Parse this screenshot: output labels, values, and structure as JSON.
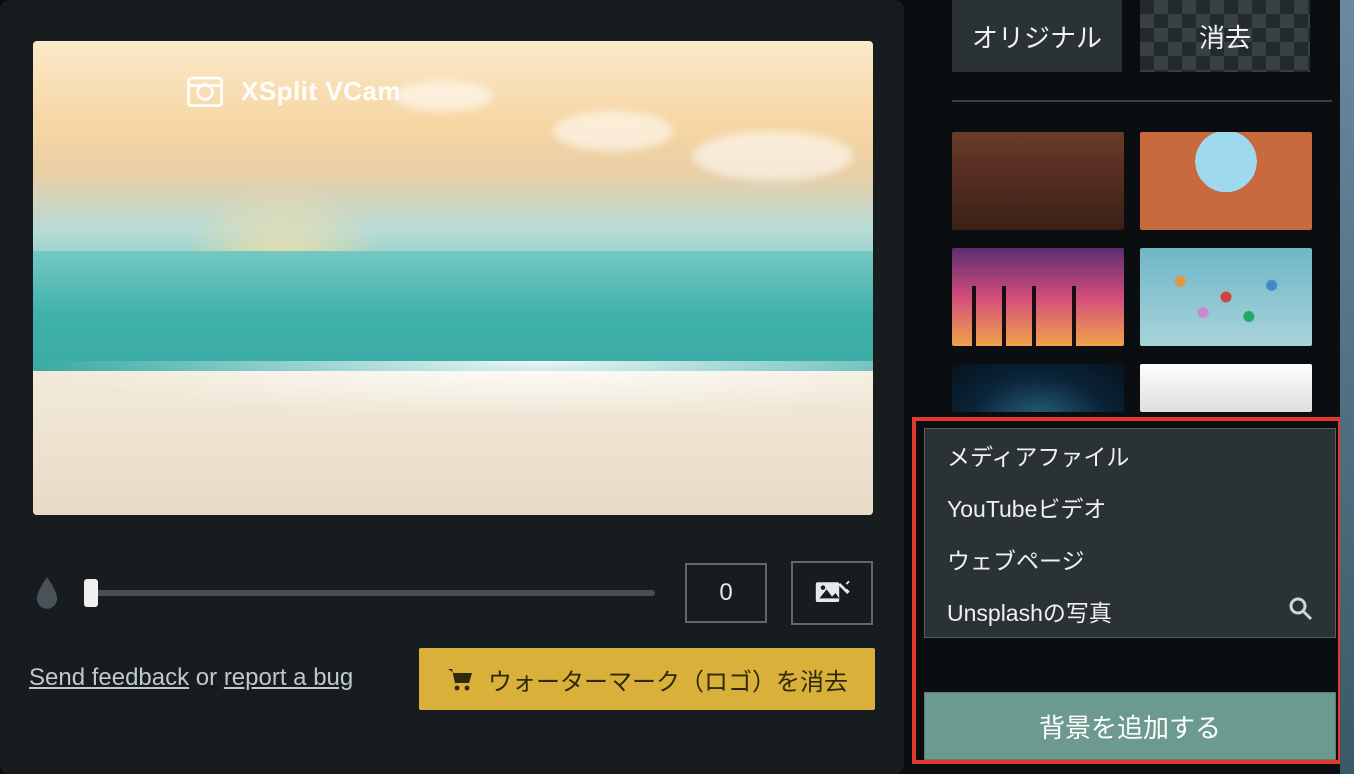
{
  "preview": {
    "watermark_text": "XSplit VCam"
  },
  "controls": {
    "blur_value": "0"
  },
  "footer": {
    "send_feedback": "Send feedback",
    "or": " or ",
    "report_bug": "report a bug"
  },
  "cta": {
    "remove_watermark_label": "ウォーターマーク（ロゴ）を消去"
  },
  "sidebar": {
    "tile_original": "オリジナル",
    "tile_remove": "消去",
    "thumbs": [
      {
        "name": "library"
      },
      {
        "name": "canyon"
      },
      {
        "name": "sunset-palms"
      },
      {
        "name": "balloons"
      },
      {
        "name": "night-sky"
      },
      {
        "name": "partial"
      }
    ]
  },
  "menu": {
    "items": [
      {
        "label": "メディアファイル"
      },
      {
        "label": "YouTubeビデオ"
      },
      {
        "label": "ウェブページ"
      },
      {
        "label": "Unsplashの写真",
        "has_search": true
      }
    ],
    "add_bg_label": "背景を追加する"
  }
}
